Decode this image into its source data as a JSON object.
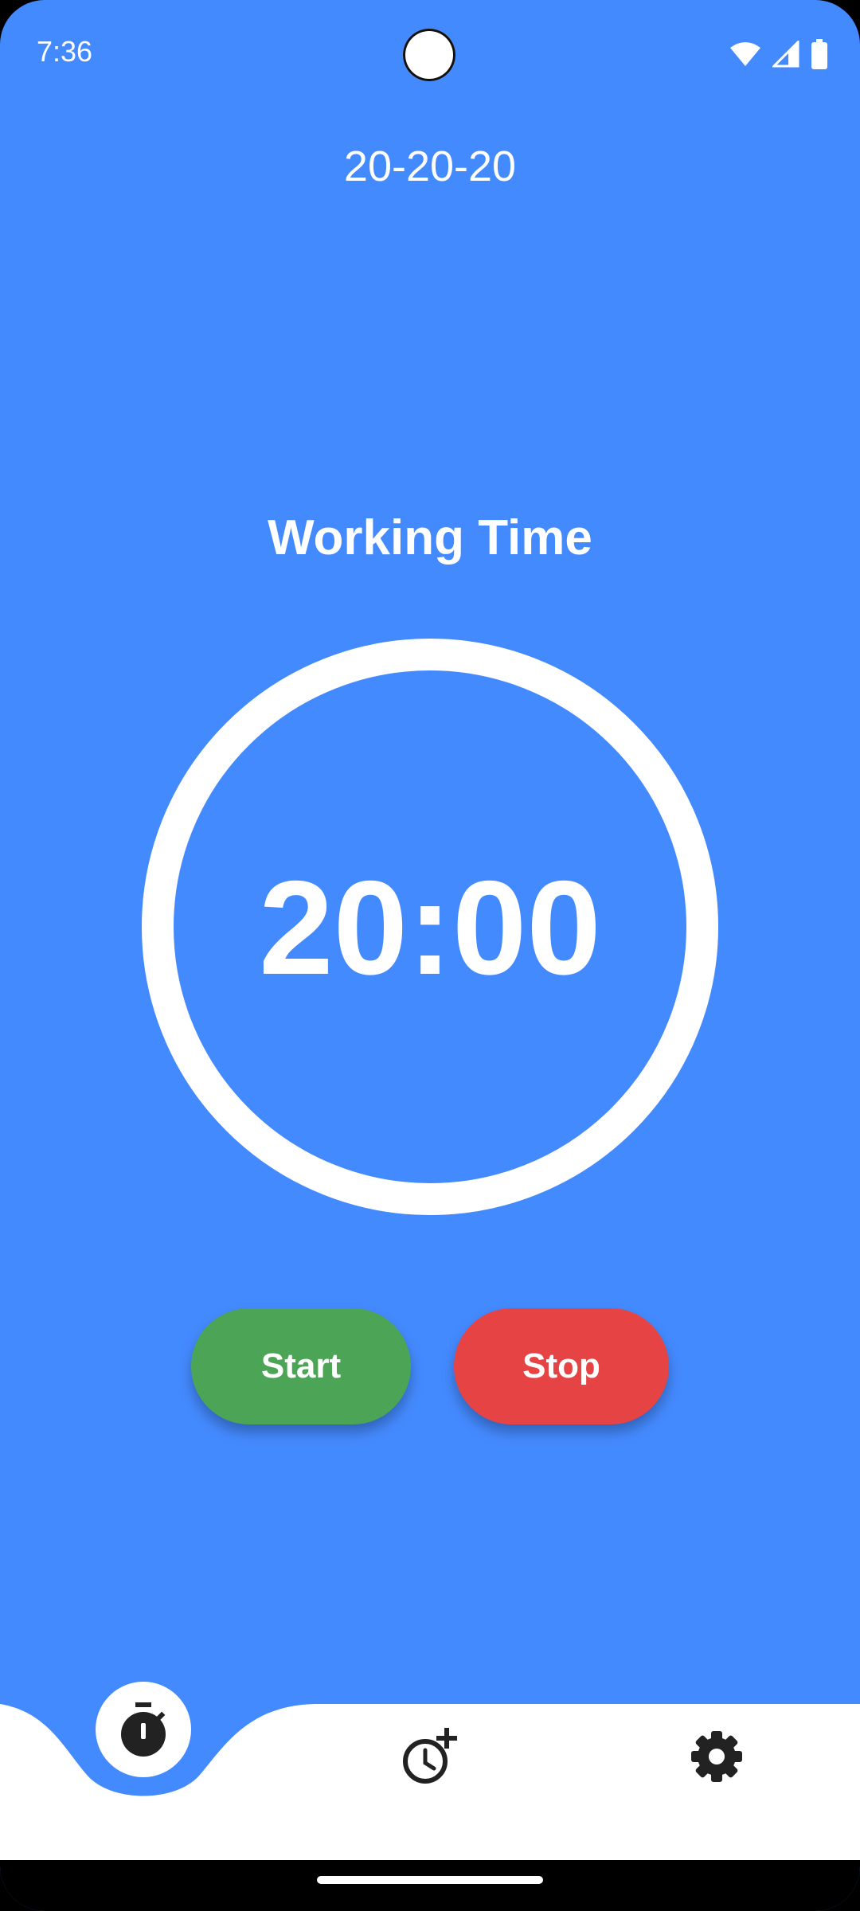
{
  "status_bar": {
    "time": "7:36",
    "icons": [
      "wifi-icon",
      "signal-icon",
      "battery-icon"
    ]
  },
  "app": {
    "title": "20-20-20"
  },
  "timer": {
    "phase_label": "Working Time",
    "value": "20:00"
  },
  "buttons": {
    "start_label": "Start",
    "stop_label": "Stop"
  },
  "bottom_nav": {
    "items": [
      {
        "icon": "stopwatch-icon",
        "active": true
      },
      {
        "icon": "add-alarm-icon",
        "active": false
      },
      {
        "icon": "gear-icon",
        "active": false
      }
    ]
  },
  "colors": {
    "background": "#448AFF",
    "start": "#4CA557",
    "stop": "#E64444",
    "text": "#FFFFFF",
    "icon": "#222222"
  }
}
